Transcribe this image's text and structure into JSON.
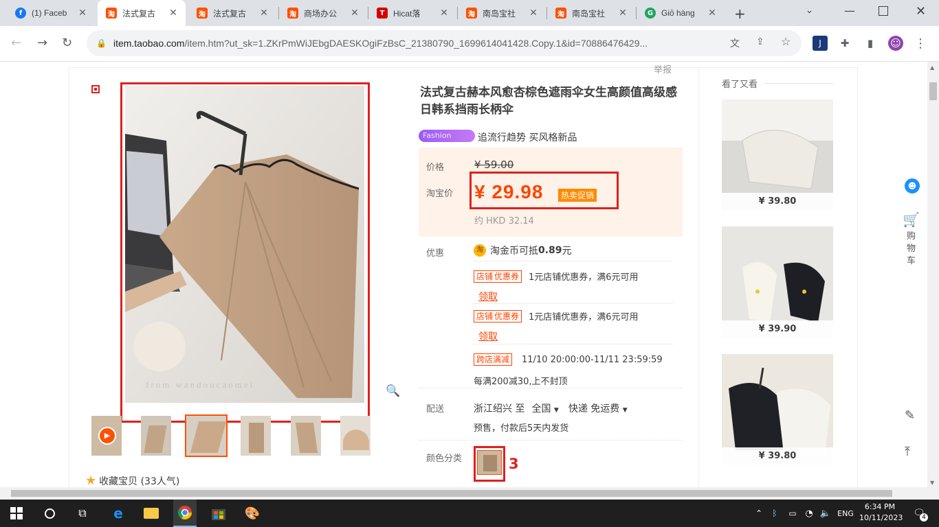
{
  "browser": {
    "tabs": [
      {
        "title": "(1) Faceb",
        "icon": "facebook-icon",
        "color": "#1877f2",
        "glyph": "f"
      },
      {
        "title": "法式复古",
        "icon": "taobao-icon",
        "color": "#ff5000",
        "glyph": "淘"
      },
      {
        "title": "法式复古",
        "icon": "taobao-icon",
        "color": "#ff5000",
        "glyph": "淘"
      },
      {
        "title": "商场办公",
        "icon": "taobao-icon",
        "color": "#ff5000",
        "glyph": "淘"
      },
      {
        "title": "Hicat落",
        "icon": "tmall-icon",
        "color": "#d50000",
        "glyph": "T"
      },
      {
        "title": "南岛宝社",
        "icon": "taobao-icon",
        "color": "#ff5000",
        "glyph": "淘"
      },
      {
        "title": "南岛宝社",
        "icon": "taobao-icon",
        "color": "#ff5000",
        "glyph": "淘"
      },
      {
        "title": "Giỏ hàng",
        "icon": "cart-site-icon",
        "color": "#1fa463",
        "glyph": "G"
      }
    ],
    "url_host": "item.taobao.com",
    "url_rest": "/item.htm?ut_sk=1.ZKrPmWiJEbgDAESKOgiFzBsC_21380790_1699614041428.Copy.1&id=70886476429..."
  },
  "product": {
    "report": "举报",
    "title": "法式复古赫本风愈杏棕色遮雨伞女生高颜值高级感日韩系挡雨长柄伞",
    "fashion_badge": "Fashion",
    "fashion_text": "追流行趋势 买风格新品",
    "price_label": "价格",
    "original_price": "¥ 59.00",
    "taobao_price_label": "淘宝价",
    "price": "¥ 29.98",
    "hot_tag": "热卖促销",
    "hkd": "约 HKD 32.14",
    "promo_label": "优惠",
    "coin_icon_text": "淘",
    "coin_prefix": "淘金币可抵",
    "coin_value": "0.89",
    "coin_suffix": "元",
    "coupons": [
      {
        "tag": "店铺 优惠券",
        "text": "1元店铺优惠券，满6元可用",
        "claim": "领取"
      },
      {
        "tag": "店铺 优惠券",
        "text": "1元店铺优惠券，满6元可用",
        "claim": "领取"
      }
    ],
    "cross_tag": "跨店满减",
    "cross_time": "11/10 20:00:00-11/11 23:59:59",
    "cross_text": "每满200减30,上不封顶",
    "ship_label": "配送",
    "ship_from": "浙江绍兴 至",
    "ship_to": "全国",
    "ship_method": "快递 免运费",
    "ship_note": "预售，付款后5天内发货",
    "color_label": "颜色分类",
    "annotation_number": "3",
    "favorite": "收藏宝贝 (33人气)",
    "watermark": "from wandoucaomei"
  },
  "sidebar": {
    "title": "看了又看",
    "items": [
      {
        "price": "¥ 39.80"
      },
      {
        "price": "¥ 39.90"
      },
      {
        "price": "¥ 39.80"
      }
    ],
    "cart_label": "购物车"
  },
  "taskbar": {
    "time": "6:34 PM",
    "date": "10/11/2023",
    "lang": "ENG",
    "notif_count": "4"
  }
}
